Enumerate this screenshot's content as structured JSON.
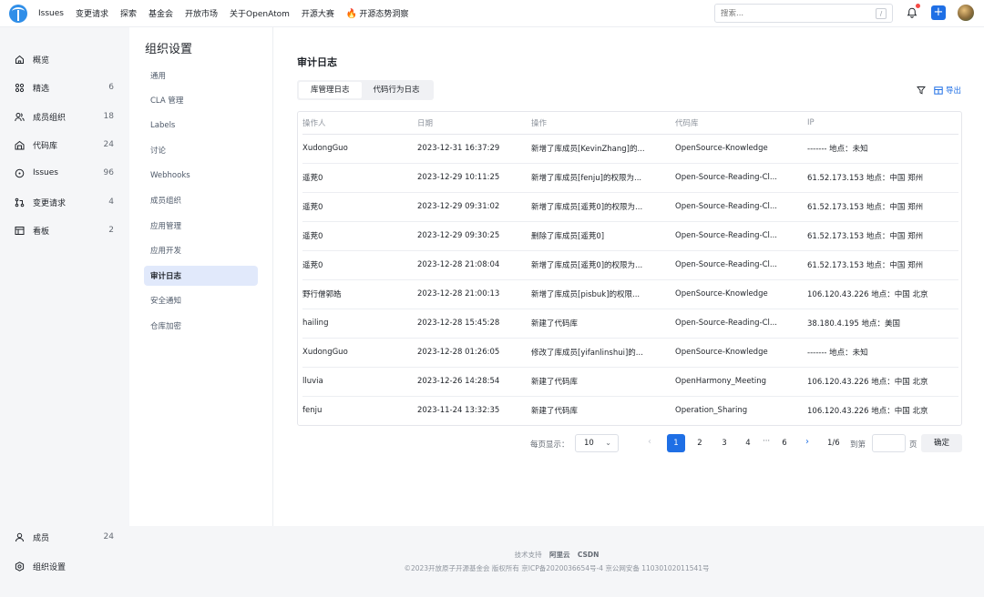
{
  "topnav": {
    "items": [
      "Issues",
      "变更请求",
      "探索",
      "基金会",
      "开放市场",
      "关于OpenAtom",
      "开源大赛"
    ],
    "insight": "开源态势洞察",
    "search_placeholder": "搜索...",
    "search_shortcut": "/"
  },
  "sidebar": {
    "items": [
      {
        "label": "概览",
        "count": "",
        "icon": "home-icon"
      },
      {
        "label": "精选",
        "count": "6",
        "icon": "grid-icon"
      },
      {
        "label": "成员组织",
        "count": "18",
        "icon": "users-icon"
      },
      {
        "label": "代码库",
        "count": "24",
        "icon": "repo-icon"
      },
      {
        "label": "Issues",
        "count": "96",
        "icon": "issue-icon"
      },
      {
        "label": "变更请求",
        "count": "4",
        "icon": "pull-request-icon"
      },
      {
        "label": "看板",
        "count": "2",
        "icon": "board-icon"
      }
    ],
    "bottom": [
      {
        "label": "成员",
        "count": "24",
        "icon": "user-icon"
      },
      {
        "label": "组织设置",
        "count": "",
        "icon": "settings-icon"
      }
    ]
  },
  "settings": {
    "title": "组织设置",
    "items": [
      "通用",
      "CLA 管理",
      "Labels",
      "讨论",
      "Webhooks",
      "成员组织",
      "应用管理",
      "应用开发",
      "审计日志",
      "安全通知",
      "仓库加密"
    ],
    "active_index": 8
  },
  "main": {
    "title": "审计日志",
    "tabs": [
      "库管理日志",
      "代码行为日志"
    ],
    "active_tab": 0,
    "export_label": "导出"
  },
  "table": {
    "headers": [
      "操作人",
      "日期",
      "操作",
      "代码库",
      "IP"
    ],
    "rows": [
      [
        "XudongGuo",
        "2023-12-31 16:37:29",
        "新增了库成员[KevinZhang]的...",
        "OpenSource-Knowledge",
        "------- 地点：未知"
      ],
      [
        "遥茺0",
        "2023-12-29 10:11:25",
        "新增了库成员[fenju]的权限为...",
        "Open-Source-Reading-Cl...",
        "61.52.173.153 地点：中国 郑州"
      ],
      [
        "遥茺0",
        "2023-12-29 09:31:02",
        "新增了库成员[遥茺0]的权限为...",
        "Open-Source-Reading-Cl...",
        "61.52.173.153 地点：中国 郑州"
      ],
      [
        "遥茺0",
        "2023-12-29 09:30:25",
        "删除了库成员[遥茺0]",
        "Open-Source-Reading-Cl...",
        "61.52.173.153 地点：中国 郑州"
      ],
      [
        "遥茺0",
        "2023-12-28 21:08:04",
        "新增了库成员[遥茺0]的权限为...",
        "Open-Source-Reading-Cl...",
        "61.52.173.153 地点：中国 郑州"
      ],
      [
        "野行僧郭皓",
        "2023-12-28 21:00:13",
        "新增了库成员[pisbuk]的权限...",
        "OpenSource-Knowledge",
        "106.120.43.226 地点：中国 北京"
      ],
      [
        "hailing",
        "2023-12-28 15:45:28",
        "新建了代码库",
        "Open-Source-Reading-Cl...",
        "38.180.4.195 地点：美国"
      ],
      [
        "XudongGuo",
        "2023-12-28 01:26:05",
        "修改了库成员[yifanlinshui]的...",
        "OpenSource-Knowledge",
        "------- 地点：未知"
      ],
      [
        "lluvia",
        "2023-12-26 14:28:54",
        "新建了代码库",
        "OpenHarmony_Meeting",
        "106.120.43.226 地点：中国 北京"
      ],
      [
        "fenju",
        "2023-11-24 13:32:35",
        "新建了代码库",
        "Operation_Sharing",
        "106.120.43.226 地点：中国 北京"
      ]
    ]
  },
  "pagination": {
    "per_page_label": "每页显示：",
    "per_page": "10",
    "pages": [
      "1",
      "2",
      "3",
      "4",
      "6"
    ],
    "current": "1",
    "ellipsis": "···",
    "total": "1/6",
    "goto_label": "到第",
    "page_label": "页",
    "confirm": "确定"
  },
  "footer": {
    "support_label": "技术支持",
    "support_brands": [
      "阿里云",
      "CSDN"
    ],
    "copyright": "©2023开放原子开源基金会 版权所有  京ICP备2020036654号-4  京公网安备 11030102011541号"
  },
  "colors": {
    "accent": "#1f6fe5",
    "active_bg": "#e1e9fb",
    "sidebar_bg": "#f5f6f8"
  }
}
